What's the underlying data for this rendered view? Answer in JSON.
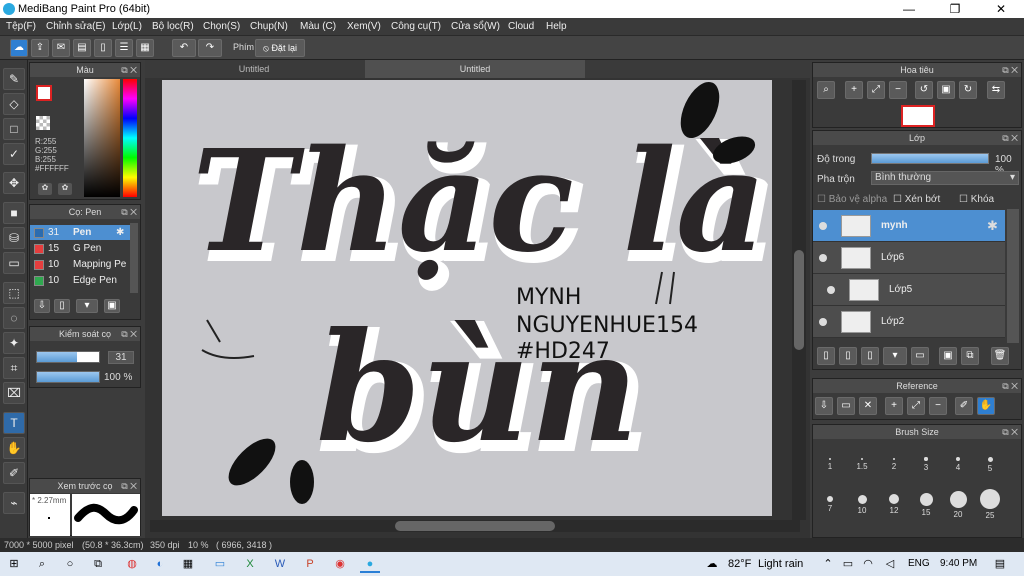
{
  "window": {
    "title": "MediBang Paint Pro (64bit)",
    "min": "—",
    "max": "❐",
    "close": "✕"
  },
  "menu": [
    "Tệp(F)",
    "Chỉnh sửa(E)",
    "Lớp(L)",
    "Bộ lọc(R)",
    "Chọn(S)",
    "Chụp(N)",
    "Màu (C)",
    "Xem(V)",
    "Công cụ(T)",
    "Cửa sổ(W)",
    "Cloud",
    "Help"
  ],
  "toolbar": {
    "shortcut_label": "Phím",
    "reset_label": "Đặt lại"
  },
  "tabs": [
    "Untitled",
    "Untitled"
  ],
  "color_panel": {
    "title": "Màu",
    "r": "R:255",
    "g": "G:255",
    "b": "B:255",
    "hex": "#FFFFFF"
  },
  "brush_panel": {
    "title": "Cọ: Pen",
    "items": [
      {
        "size": "31",
        "name": "Pen",
        "color": "#2b6cb0",
        "selected": true
      },
      {
        "size": "15",
        "name": "G Pen",
        "color": "#e53e3e"
      },
      {
        "size": "10",
        "name": "Mapping Pe",
        "color": "#e53e3e"
      },
      {
        "size": "10",
        "name": "Edge Pen",
        "color": "#2fa84f"
      }
    ]
  },
  "brush_control": {
    "title": "Kiểm soát cọ",
    "size": "31",
    "opacity": "100 %",
    "size_fill": 0.65,
    "opacity_fill": 1.0
  },
  "preview_panel": {
    "title": "Xem trước cọ",
    "size": "2.27mm"
  },
  "canvas_art": {
    "line1": "Thặc là",
    "line2": "bùn",
    "sig1": "MYNH",
    "sig2": "NGUYENHUE154",
    "sig3": "#HD247"
  },
  "navigator": {
    "title": "Hoa tiêu"
  },
  "layer_panel": {
    "title": "Lớp",
    "opacity_label": "Độ trong",
    "opacity_value": "100 %",
    "blend_label": "Pha trộn",
    "blend_value": "Bình thường",
    "protect_alpha": "Bảo vệ alpha",
    "clipping": "Xén bớt",
    "lock": "Khóa",
    "layers": [
      {
        "name": "mynh",
        "active": true
      },
      {
        "name": "Lớp6",
        "active": false
      },
      {
        "name": "Lớp5",
        "active": false
      },
      {
        "name": "Lớp2",
        "active": false
      }
    ]
  },
  "reference_panel": {
    "title": "Reference"
  },
  "brush_size_panel": {
    "title": "Brush Size",
    "sizes": [
      "1",
      "1.5",
      "2",
      "3",
      "4",
      "5",
      "7",
      "10",
      "12",
      "15",
      "20",
      "25"
    ]
  },
  "status": {
    "dimensions": "7000 * 5000 pixel",
    "size_cm": "(50.8 * 36.3cm)",
    "dpi": "350 dpi",
    "zoom": "10 %",
    "coords": "( 6966, 3418 )"
  },
  "taskbar": {
    "temp": "82°F",
    "weather": "Light rain",
    "lang": "ENG",
    "time": "9:40 PM"
  },
  "colors": {
    "accent": "#5b9bd5",
    "active_layer": "#4d8fd1"
  }
}
